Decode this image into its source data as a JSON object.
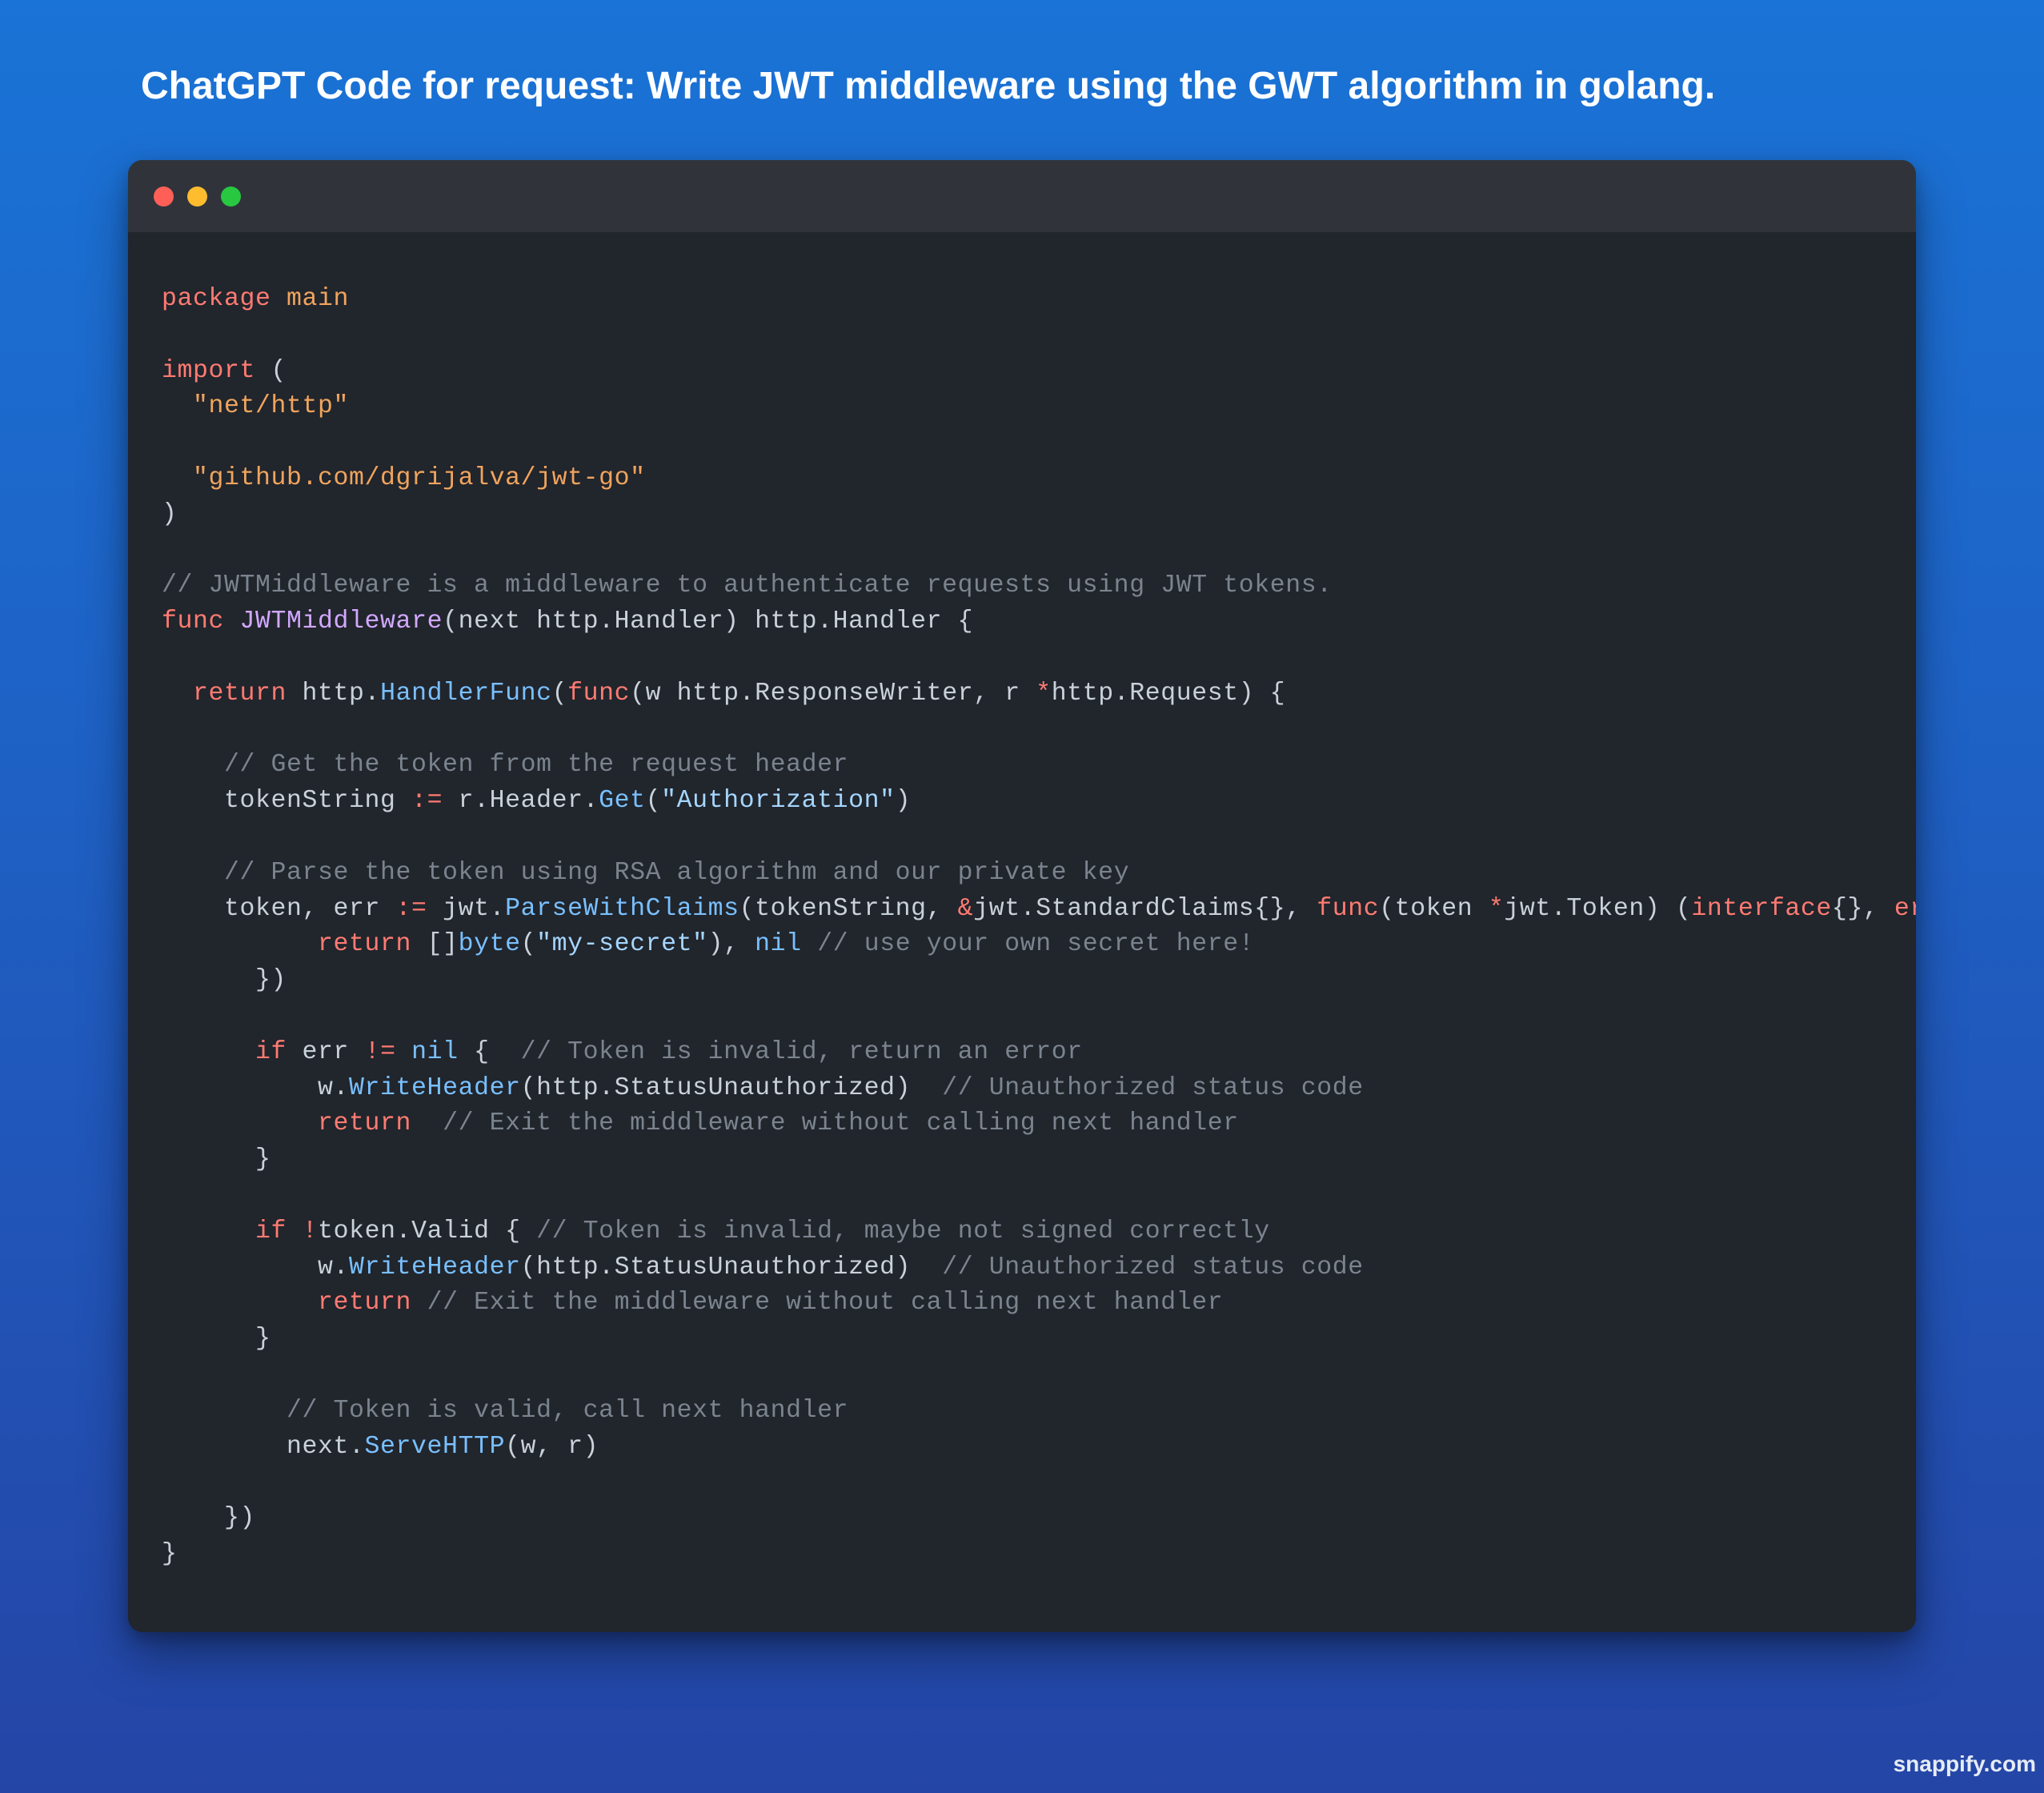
{
  "page": {
    "title": "ChatGPT Code for request: Write JWT middleware using the GWT algorithm in golang.",
    "watermark": "snappify.com"
  },
  "window": {
    "traffic_lights": [
      {
        "name": "close",
        "color": "#ff5f57"
      },
      {
        "name": "minimize",
        "color": "#febc2e"
      },
      {
        "name": "zoom",
        "color": "#28c840"
      }
    ]
  },
  "colors": {
    "keyword": "#ff7b72",
    "string": "#a5d6ff",
    "import_string": "#f0a45d",
    "comment": "#7b848e",
    "function_name": "#d2a8ff",
    "method": "#79c0ff",
    "text": "#c9d1d9",
    "code_background": "#21252c",
    "title_bar": "#30343a"
  },
  "code": {
    "language": "go",
    "lines": [
      [
        {
          "t": "keyword",
          "v": "package"
        },
        {
          "t": "plain",
          "v": " "
        },
        {
          "t": "import-string",
          "v": "main"
        }
      ],
      [],
      [
        {
          "t": "keyword",
          "v": "import"
        },
        {
          "t": "plain",
          "v": " ("
        }
      ],
      [
        {
          "t": "plain",
          "v": "  "
        },
        {
          "t": "import-string",
          "v": "\"net/http\""
        }
      ],
      [],
      [
        {
          "t": "plain",
          "v": "  "
        },
        {
          "t": "import-string",
          "v": "\"github.com/dgrijalva/jwt-go\""
        }
      ],
      [
        {
          "t": "plain",
          "v": ")"
        }
      ],
      [],
      [
        {
          "t": "comment",
          "v": "// JWTMiddleware is a middleware to authenticate requests using JWT tokens."
        }
      ],
      [
        {
          "t": "keyword",
          "v": "func"
        },
        {
          "t": "plain",
          "v": " "
        },
        {
          "t": "func-name",
          "v": "JWTMiddleware"
        },
        {
          "t": "plain",
          "v": "(next http.Handler) http.Handler {"
        }
      ],
      [],
      [
        {
          "t": "plain",
          "v": "  "
        },
        {
          "t": "keyword",
          "v": "return"
        },
        {
          "t": "plain",
          "v": " http."
        },
        {
          "t": "method",
          "v": "HandlerFunc"
        },
        {
          "t": "plain",
          "v": "("
        },
        {
          "t": "keyword",
          "v": "func"
        },
        {
          "t": "plain",
          "v": "(w http.ResponseWriter, r "
        },
        {
          "t": "keyword",
          "v": "*"
        },
        {
          "t": "plain",
          "v": "http.Request) {"
        }
      ],
      [],
      [
        {
          "t": "plain",
          "v": "    "
        },
        {
          "t": "comment",
          "v": "// Get the token from the request header"
        }
      ],
      [
        {
          "t": "plain",
          "v": "    tokenString "
        },
        {
          "t": "keyword",
          "v": ":="
        },
        {
          "t": "plain",
          "v": " r.Header."
        },
        {
          "t": "method",
          "v": "Get"
        },
        {
          "t": "plain",
          "v": "("
        },
        {
          "t": "string",
          "v": "\"Authorization\""
        },
        {
          "t": "plain",
          "v": ")"
        }
      ],
      [],
      [
        {
          "t": "plain",
          "v": "    "
        },
        {
          "t": "comment",
          "v": "// Parse the token using RSA algorithm and our private key"
        }
      ],
      [
        {
          "t": "plain",
          "v": "    token, err "
        },
        {
          "t": "keyword",
          "v": ":="
        },
        {
          "t": "plain",
          "v": " jwt."
        },
        {
          "t": "method",
          "v": "ParseWithClaims"
        },
        {
          "t": "plain",
          "v": "(tokenString, "
        },
        {
          "t": "keyword",
          "v": "&"
        },
        {
          "t": "plain",
          "v": "jwt.StandardClaims{}, "
        },
        {
          "t": "keyword",
          "v": "func"
        },
        {
          "t": "plain",
          "v": "(token "
        },
        {
          "t": "keyword",
          "v": "*"
        },
        {
          "t": "plain",
          "v": "jwt.Token) ("
        },
        {
          "t": "keyword",
          "v": "interface"
        },
        {
          "t": "plain",
          "v": "{}, "
        },
        {
          "t": "keyword",
          "v": "error"
        },
        {
          "t": "plain",
          "v": ")"
        }
      ],
      [
        {
          "t": "plain",
          "v": "          "
        },
        {
          "t": "keyword",
          "v": "return"
        },
        {
          "t": "plain",
          "v": " []"
        },
        {
          "t": "method",
          "v": "byte"
        },
        {
          "t": "plain",
          "v": "("
        },
        {
          "t": "string",
          "v": "\"my-secret\""
        },
        {
          "t": "plain",
          "v": "), "
        },
        {
          "t": "method",
          "v": "nil"
        },
        {
          "t": "plain",
          "v": " "
        },
        {
          "t": "comment",
          "v": "// use your own secret here!"
        }
      ],
      [
        {
          "t": "plain",
          "v": "      })"
        }
      ],
      [],
      [
        {
          "t": "plain",
          "v": "      "
        },
        {
          "t": "keyword",
          "v": "if"
        },
        {
          "t": "plain",
          "v": " err "
        },
        {
          "t": "keyword",
          "v": "!="
        },
        {
          "t": "plain",
          "v": " "
        },
        {
          "t": "method",
          "v": "nil"
        },
        {
          "t": "plain",
          "v": " {  "
        },
        {
          "t": "comment",
          "v": "// Token is invalid, return an error"
        }
      ],
      [
        {
          "t": "plain",
          "v": "          w."
        },
        {
          "t": "method",
          "v": "WriteHeader"
        },
        {
          "t": "plain",
          "v": "(http.StatusUnauthorized)  "
        },
        {
          "t": "comment",
          "v": "// Unauthorized status code"
        }
      ],
      [
        {
          "t": "plain",
          "v": "          "
        },
        {
          "t": "keyword",
          "v": "return"
        },
        {
          "t": "plain",
          "v": "  "
        },
        {
          "t": "comment",
          "v": "// Exit the middleware without calling next handler"
        }
      ],
      [
        {
          "t": "plain",
          "v": "      }"
        }
      ],
      [],
      [
        {
          "t": "plain",
          "v": "      "
        },
        {
          "t": "keyword",
          "v": "if"
        },
        {
          "t": "plain",
          "v": " "
        },
        {
          "t": "keyword",
          "v": "!"
        },
        {
          "t": "plain",
          "v": "token.Valid { "
        },
        {
          "t": "comment",
          "v": "// Token is invalid, maybe not signed correctly"
        }
      ],
      [
        {
          "t": "plain",
          "v": "          w."
        },
        {
          "t": "method",
          "v": "WriteHeader"
        },
        {
          "t": "plain",
          "v": "(http.StatusUnauthorized)  "
        },
        {
          "t": "comment",
          "v": "// Unauthorized status code"
        }
      ],
      [
        {
          "t": "plain",
          "v": "          "
        },
        {
          "t": "keyword",
          "v": "return"
        },
        {
          "t": "plain",
          "v": " "
        },
        {
          "t": "comment",
          "v": "// Exit the middleware without calling next handler"
        }
      ],
      [
        {
          "t": "plain",
          "v": "      }"
        }
      ],
      [],
      [
        {
          "t": "plain",
          "v": "        "
        },
        {
          "t": "comment",
          "v": "// Token is valid, call next handler"
        }
      ],
      [
        {
          "t": "plain",
          "v": "        next."
        },
        {
          "t": "method",
          "v": "ServeHTTP"
        },
        {
          "t": "plain",
          "v": "(w, r)"
        }
      ],
      [],
      [
        {
          "t": "plain",
          "v": "    })"
        }
      ],
      [
        {
          "t": "plain",
          "v": "}"
        }
      ]
    ]
  }
}
